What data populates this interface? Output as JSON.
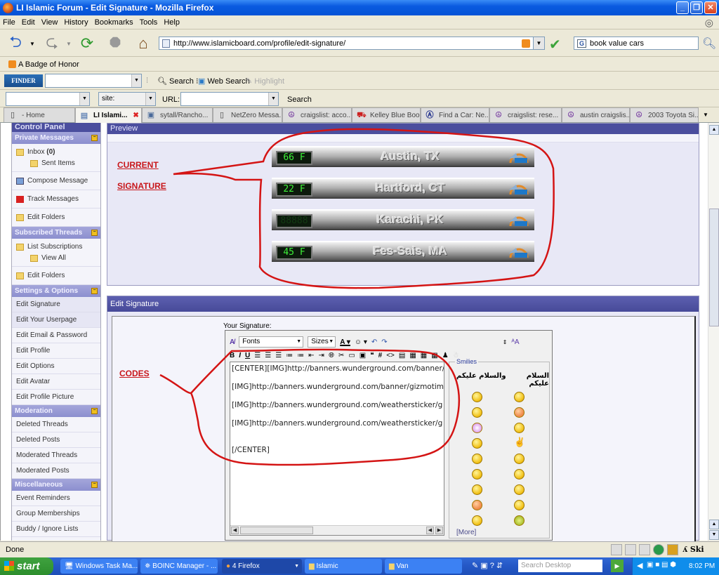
{
  "window": {
    "title": "LI Islamic Forum - Edit Signature - Mozilla Firefox",
    "buttons": [
      "minimize",
      "restore",
      "close"
    ]
  },
  "menu": [
    "File",
    "Edit",
    "View",
    "History",
    "Bookmarks",
    "Tools",
    "Help"
  ],
  "nav": {
    "url": "http://www.islamicboard.com/profile/edit-signature/",
    "search_value": "book value cars"
  },
  "bookmarks": [
    {
      "label": "A Badge of Honor",
      "icon": "rss-icon"
    }
  ],
  "toolbar1": {
    "brand": "FINDER",
    "search_label": "Search",
    "web_search_label": "Web Search",
    "highlight_label": "Highlight"
  },
  "toolbar2": {
    "site_value": "site:",
    "url_label": "URL:",
    "search_label": "Search"
  },
  "tabs": [
    {
      "label": "- Home",
      "icon": "page-icon",
      "active": false
    },
    {
      "label": "LI Islami...",
      "icon": "page-icon",
      "active": true
    },
    {
      "label": "sytall/Rancho...",
      "icon": "image-icon",
      "active": false
    },
    {
      "label": "NetZero Messa...",
      "icon": "page-icon",
      "active": false
    },
    {
      "label": "craigslist: acco...",
      "icon": "peace-icon",
      "active": false
    },
    {
      "label": "Kelley Blue Boo...",
      "icon": "car-icon",
      "active": false
    },
    {
      "label": "Find a Car: Ne...",
      "icon": "a-logo-icon",
      "active": false
    },
    {
      "label": "craigslist: rese...",
      "icon": "peace-icon",
      "active": false
    },
    {
      "label": "austin craigslis...",
      "icon": "peace-icon",
      "active": false
    },
    {
      "label": "2003 Toyota Si...",
      "icon": "peace-icon",
      "active": false
    }
  ],
  "sidebar": {
    "title": "Control Panel",
    "sections": [
      {
        "title": "Private Messages",
        "items": [
          {
            "label": "Inbox",
            "count": "(0)",
            "icon": "folder-icon"
          },
          {
            "label": "Sent Items",
            "icon": "folder-icon",
            "sub": true
          },
          {
            "label": "Compose Message",
            "icon": "compose-icon"
          },
          {
            "label": "Track Messages",
            "icon": "flag-icon"
          },
          {
            "label": "Edit Folders",
            "icon": "folder-icon"
          }
        ]
      },
      {
        "title": "Subscribed Threads",
        "items": [
          {
            "label": "List Subscriptions",
            "icon": "folder-icon"
          },
          {
            "label": "View All",
            "icon": "folder-icon",
            "sub": true
          },
          {
            "label": "Edit Folders",
            "icon": "folder-icon"
          }
        ]
      },
      {
        "title": "Settings & Options",
        "items": [
          {
            "label": "Edit Signature"
          },
          {
            "label": "Edit Your Userpage"
          },
          {
            "label": "Edit Email & Password"
          },
          {
            "label": "Edit Profile"
          },
          {
            "label": "Edit Options"
          },
          {
            "label": "Edit Avatar"
          },
          {
            "label": "Edit Profile Picture"
          }
        ]
      },
      {
        "title": "Moderation",
        "items": [
          {
            "label": "Deleted Threads"
          },
          {
            "label": "Deleted Posts"
          },
          {
            "label": "Moderated Threads"
          },
          {
            "label": "Moderated Posts"
          }
        ]
      },
      {
        "title": "Miscellaneous",
        "items": [
          {
            "label": "Event Reminders"
          },
          {
            "label": "Group Memberships"
          },
          {
            "label": "Buddy / Ignore Lists"
          }
        ]
      }
    ]
  },
  "preview": {
    "title": "Preview",
    "annotation_1": "CURRENT",
    "annotation_2": "SIGNATURE",
    "banners": [
      {
        "temp": "66 F",
        "city": "Austin, TX"
      },
      {
        "temp": "22 F",
        "city": "Hartford, CT"
      },
      {
        "temp": "88888",
        "city": "Karachi, PK",
        "dim": true
      },
      {
        "temp": "45 F",
        "city": "Fes-Sais, MA"
      }
    ]
  },
  "edit_signature": {
    "title": "Edit Signature",
    "annotation": "CODES",
    "field_label": "Your Signature:",
    "font_select": "Fonts",
    "size_select": "Sizes",
    "format_buttons": [
      "B",
      "I",
      "U"
    ],
    "code_lines": [
      "[CENTER][IMG]http://banners.wunderground.com/banner/",
      "[IMG]http://banners.wunderground.com/banner/gizmotim",
      "[IMG]http://banners.wunderground.com/weathersticker/g",
      "[IMG]http://banners.wunderground.com/weathersticker/g",
      "[/CENTER]"
    ],
    "smilies": {
      "legend": "Smilies",
      "header_left": "والسلام عليكم",
      "header_right": "السلام عليكم",
      "more_label": "[More]"
    }
  },
  "status": {
    "text": "Done",
    "right_label": "ʎ Ski"
  },
  "taskbar": {
    "start_label": "start",
    "tasks": [
      "Windows Task Ma...",
      "BOINC Manager - ...",
      "4 Firefox",
      "Islamic",
      "Van"
    ],
    "search_placeholder": "Search Desktop",
    "clock": "8:02 PM"
  }
}
